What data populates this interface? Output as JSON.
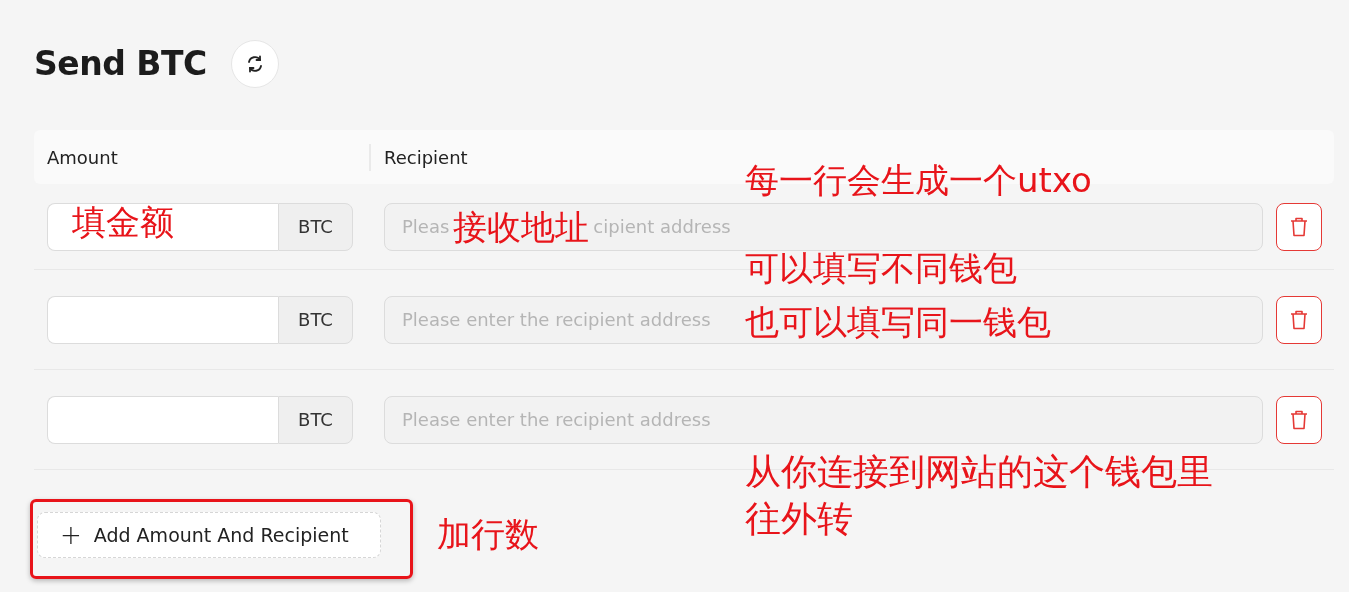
{
  "title": "Send BTC",
  "columns": [
    "Amount",
    "Recipient"
  ],
  "rows": [
    {
      "unit": "BTC",
      "placeholder_parts": [
        "Pleas",
        "cipient address"
      ]
    },
    {
      "unit": "BTC",
      "placeholder": "Please enter the recipient address"
    },
    {
      "unit": "BTC",
      "placeholder": "Please enter the recipient address"
    }
  ],
  "add_button": {
    "icon": "+",
    "label": "Add Amount And Recipient",
    "highlighted": true
  },
  "annotations": [
    {
      "kind": "amount",
      "text": "填金额"
    },
    {
      "kind": "recipient",
      "text": "接收地址"
    },
    {
      "kind": "line1",
      "text": "每一行会生成一个utxo"
    },
    {
      "kind": "line2",
      "text": "可以填写不同钱包"
    },
    {
      "kind": "line3",
      "text": "也可以填写同一钱包"
    },
    {
      "kind": "wallet",
      "text": "从你连接到网站的这个钱包里往外转"
    },
    {
      "kind": "add",
      "text": "加行数"
    }
  ]
}
